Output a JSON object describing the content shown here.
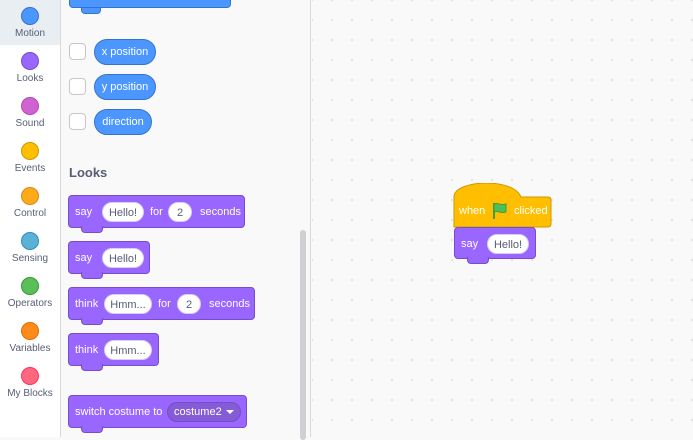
{
  "categories": [
    {
      "label": "Motion",
      "color": "#4c97ff",
      "border": "#3373cc",
      "selected": true
    },
    {
      "label": "Looks",
      "color": "#9966ff",
      "border": "#774dcb",
      "selected": false
    },
    {
      "label": "Sound",
      "color": "#cf63cf",
      "border": "#bd42bd",
      "selected": false
    },
    {
      "label": "Events",
      "color": "#ffbf00",
      "border": "#cc9900",
      "selected": false
    },
    {
      "label": "Control",
      "color": "#ffab19",
      "border": "#cf8b17",
      "selected": false
    },
    {
      "label": "Sensing",
      "color": "#5cb1d6",
      "border": "#2e8eb8",
      "selected": false
    },
    {
      "label": "Operators",
      "color": "#59c059",
      "border": "#389438",
      "selected": false
    },
    {
      "label": "Variables",
      "color": "#ff8c1a",
      "border": "#db6e00",
      "selected": false
    },
    {
      "label": "My Blocks",
      "color": "#ff6680",
      "border": "#ff3355",
      "selected": false
    }
  ],
  "palette": {
    "reporters": [
      "x position",
      "y position",
      "direction"
    ],
    "looks_title": "Looks",
    "say_for": {
      "say": "say",
      "message": "Hello!",
      "for": "for",
      "secs": "2",
      "seconds": "seconds"
    },
    "say": {
      "say": "say",
      "message": "Hello!"
    },
    "think_for": {
      "think": "think",
      "message": "Hmm...",
      "for": "for",
      "secs": "2",
      "seconds": "seconds"
    },
    "think": {
      "think": "think",
      "message": "Hmm..."
    },
    "switch_costume": {
      "label": "switch costume to",
      "value": "costume2"
    }
  },
  "script": {
    "hat": {
      "when": "when",
      "clicked": "clicked"
    },
    "say": {
      "say": "say",
      "message": "Hello!"
    }
  },
  "colors": {
    "motion": "#4c97ff",
    "looks": "#9966ff",
    "events": "#ffbf00",
    "flag": "#4cbf56"
  }
}
